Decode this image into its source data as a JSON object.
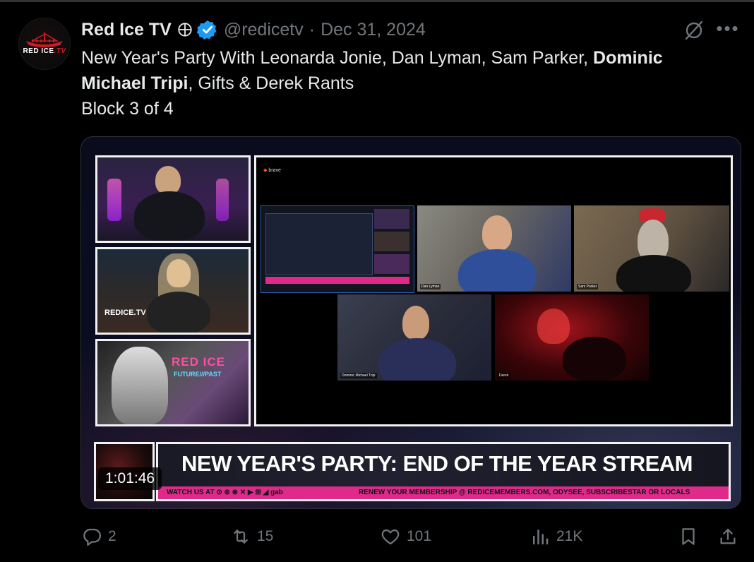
{
  "tweet": {
    "avatar_alt": "Red Ice TV avatar",
    "avatar_logo_text": "RED ICE",
    "avatar_logo_suffix": ".TV",
    "display_name": "Red Ice TV",
    "handle": "@redicetv",
    "separator": "·",
    "date": "Dec 31, 2024",
    "text_line1_plain": "New Year's Party With Leonarda Jonie, Dan Lyman, Sam Parker, ",
    "text_bold": "Dominic Michael Tripi",
    "text_line2_plain": ", Gifts & Derek Rants",
    "text_line3": "Block 3 of 4"
  },
  "media": {
    "brave_label": "brave",
    "cells": {
      "c1_label": "Dan Lyman",
      "c2_label": "Sam Parker",
      "c3_label": "Dominic Michael Tripi",
      "c4_label": "Derek"
    },
    "thumb2_text": "REDICE.TV",
    "thumb3_title": "RED ICE",
    "thumb3_sub": "FUTURE///PAST",
    "banner_title": "NEW YEAR'S PARTY: END OF THE YEAR STREAM",
    "banner_left_text": "WATCH US AT",
    "banner_gab": "gab",
    "banner_right_text": "RENEW YOUR MEMBERSHIP @ REDICEMEMBERS.COM, ODYSEE, SUBSCRIBESTAR OR LOCALS",
    "duration": "1:01:46"
  },
  "actions": {
    "replies": "2",
    "reposts": "15",
    "likes": "101",
    "views": "21K"
  },
  "colors": {
    "background": "#000000",
    "text": "#e7e9ea",
    "muted": "#71767b",
    "verified": "#1d9bf0",
    "banner_pink": "#e02a8b"
  }
}
